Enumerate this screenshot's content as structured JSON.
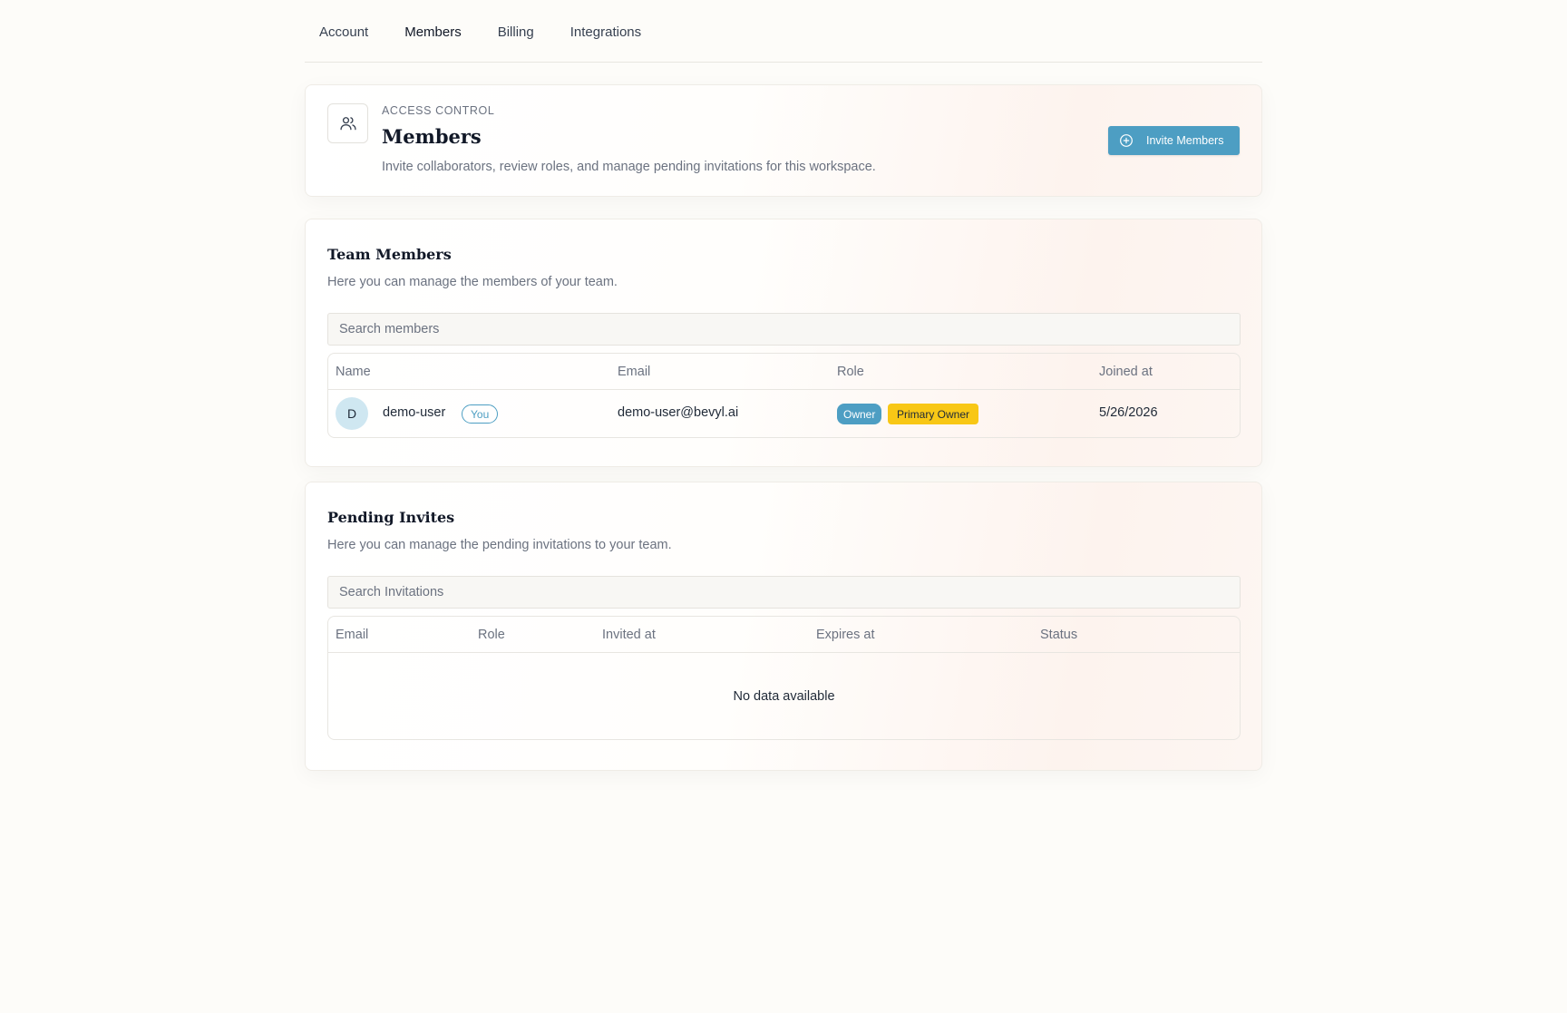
{
  "tabs": [
    "Account",
    "Members",
    "Billing",
    "Integrations"
  ],
  "header": {
    "eyebrow": "ACCESS CONTROL",
    "title": "Members",
    "description": "Invite collaborators, review roles, and manage pending invitations for this workspace.",
    "invite_button": "Invite Members"
  },
  "team": {
    "title": "Team Members",
    "description": "Here you can manage the members of your team.",
    "search_placeholder": "Search members",
    "columns": [
      "Name",
      "Email",
      "Role",
      "Joined at"
    ],
    "rows": [
      {
        "avatar": "D",
        "name": "demo-user",
        "you_badge": "You",
        "email": "demo-user@bevyl.ai",
        "roles": [
          "Owner",
          "Primary Owner"
        ],
        "joined": "5/26/2026"
      }
    ]
  },
  "invites": {
    "title": "Pending Invites",
    "description": "Here you can manage the pending invitations to your team.",
    "search_placeholder": "Search Invitations",
    "columns": [
      "Email",
      "Role",
      "Invited at",
      "Expires at",
      "Status"
    ],
    "empty_text": "No data available"
  },
  "colors": {
    "accent": "#4d9ec3",
    "primary_owner_badge": "#f8c716",
    "background": "#fdfcf9"
  },
  "icons": {
    "header": "users-icon",
    "invite_button": "plus-circle-icon"
  }
}
